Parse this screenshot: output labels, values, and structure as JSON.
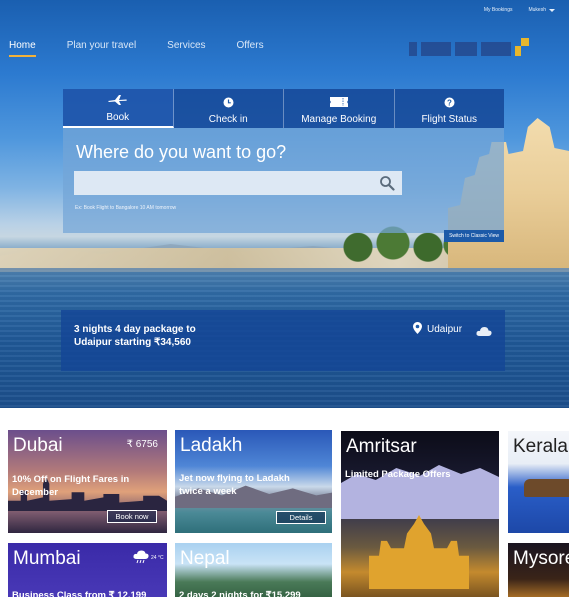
{
  "header": {
    "my_bookings": "My Bookings",
    "user_name": "Mukesh",
    "nav": [
      {
        "label": "Home",
        "active": true
      },
      {
        "label": "Plan your travel"
      },
      {
        "label": "Services"
      },
      {
        "label": "Offers"
      }
    ]
  },
  "booking": {
    "tabs": [
      {
        "label": "Book",
        "icon": "plane-icon",
        "active": true
      },
      {
        "label": "Check in",
        "icon": "clock-icon"
      },
      {
        "label": "Manage Booking",
        "icon": "ticket-icon"
      },
      {
        "label": "Flight Status",
        "icon": "question-icon"
      }
    ],
    "heading": "Where do you want to go?",
    "search_placeholder": "",
    "hint": "Ex: Book Flight to Bangalore 10 AM tomorrow",
    "classic_view": "Switch to Classic View"
  },
  "promo": {
    "text": "3 nights 4 day package to Udaipur starting ₹34,560",
    "location": "Udaipur",
    "weather_icon": "cloud-icon"
  },
  "cards": {
    "dubai": {
      "title": "Dubai",
      "price": "₹ 6756",
      "subtitle": "10% Off on Flight Fares in December",
      "button": "Book now"
    },
    "ladakh": {
      "title": "Ladakh",
      "subtitle": "Jet now flying to Ladakh twice a week",
      "button": "Details"
    },
    "amritsar": {
      "title": "Amritsar",
      "subtitle": "Limited Package Offers"
    },
    "kerala": {
      "title": "Kerala"
    },
    "mumbai": {
      "title": "Mumbai",
      "subtitle": "Business Class from ₹ 12,199",
      "temperature": "24 °C",
      "weather_icon": "rain-cloud-icon"
    },
    "nepal": {
      "title": "Nepal",
      "subtitle": "2 days 2 nights for ₹15,299"
    },
    "mysore": {
      "title": "Mysore"
    }
  },
  "colors": {
    "accent": "#f3b23a",
    "panel_blue": "#1c5aa8"
  }
}
